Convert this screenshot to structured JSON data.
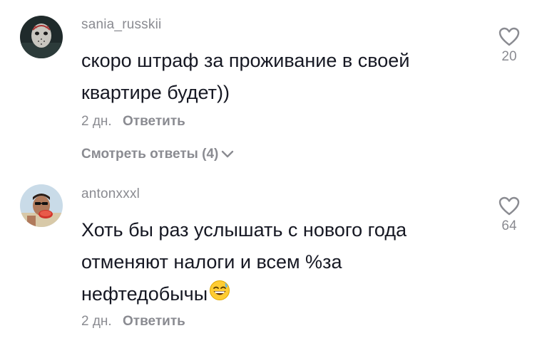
{
  "comments": [
    {
      "username": "sania_russkii",
      "text_line1": "скоро штраф за проживание в своей",
      "text_line2": "квартире будет))",
      "time": "2 дн.",
      "reply_label": "Ответить",
      "likes": "20",
      "view_replies": "Смотреть ответы (4)"
    },
    {
      "username": "antonxxxl",
      "text_line1": "Хоть бы раз услышать с нового года",
      "text_line2": "отменяют налоги и всем %за",
      "text_line3": "нефтедобычы",
      "time": "2 дн.",
      "reply_label": "Ответить",
      "likes": "64"
    }
  ],
  "icons": {
    "like": "heart-outline-icon",
    "expand": "chevron-down-icon",
    "emoji": "grinning-sweat-emoji"
  },
  "colors": {
    "primary_text": "#161823",
    "secondary_text": "#8a8b91"
  }
}
